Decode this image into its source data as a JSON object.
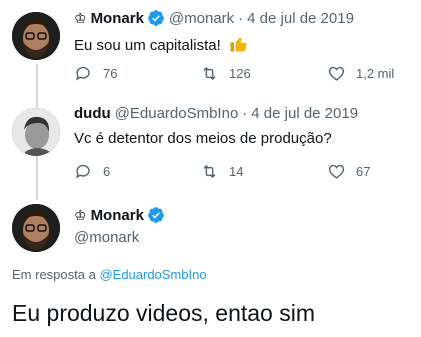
{
  "tweet1": {
    "crown": "♔",
    "name": "Monark",
    "handle": "@monark",
    "separator": "·",
    "date": "4 de jul de 2019",
    "text": "Eu sou um capitalista!",
    "emoji": "thumbs-up-emoji",
    "replies": "76",
    "retweets": "126",
    "likes": "1,2 mil"
  },
  "tweet2": {
    "name": "dudu",
    "handle": "@EduardoSmbIno",
    "separator": "·",
    "date": "4 de jul de 2019",
    "text": "Vc é detentor dos meios de produção?",
    "replies": "6",
    "retweets": "14",
    "likes": "67"
  },
  "main": {
    "crown": "♔",
    "name": "Monark",
    "handle": "@monark",
    "reply_prefix": "Em resposta a",
    "reply_to": "@EduardoSmbIno",
    "text": "Eu produzo videos, entao sim"
  },
  "colors": {
    "verified": "#1d9bf0",
    "link": "#1d9bf0",
    "muted": "#536471",
    "thread_line": "#cfd9de"
  },
  "icons": [
    "reply-icon",
    "retweet-icon",
    "like-icon",
    "verified-badge-icon",
    "crown-icon"
  ]
}
